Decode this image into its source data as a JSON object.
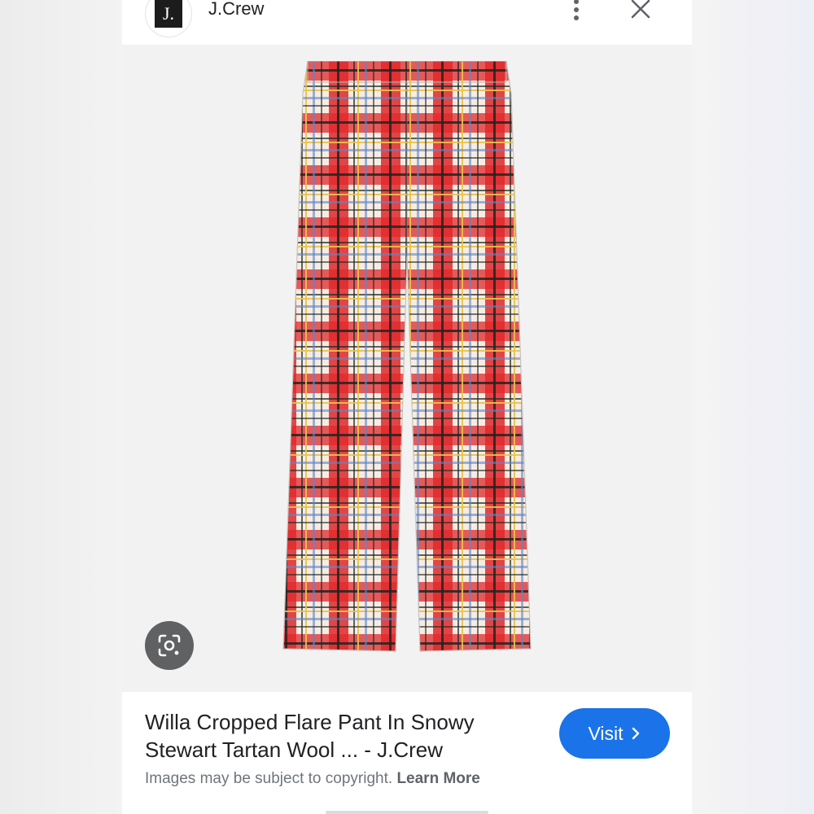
{
  "header": {
    "logo_text": "J.",
    "site_name": "J.Crew",
    "more_icon": "more-vertical-icon",
    "close_icon": "close-icon"
  },
  "image": {
    "alt": "Willa Cropped Flare Pant In Snowy Stewart Tartan Wool",
    "lens_icon": "google-lens-icon",
    "colors": {
      "red": "#e0282a",
      "cream": "#f6ece3",
      "dark": "#1f2622",
      "blue": "#5f86c4",
      "yellow": "#e5c54a"
    }
  },
  "result": {
    "title": "Willa Cropped Flare Pant In Snowy Stewart Tartan Wool ... - J.Crew",
    "visit_label": "Visit",
    "visit_icon": "chevron-right-icon",
    "copyright_text": "Images may be subject to copyright.",
    "learn_more_label": "Learn More"
  },
  "colors": {
    "accent": "#1a73e8",
    "text": "#202124",
    "muted": "#70757a"
  }
}
